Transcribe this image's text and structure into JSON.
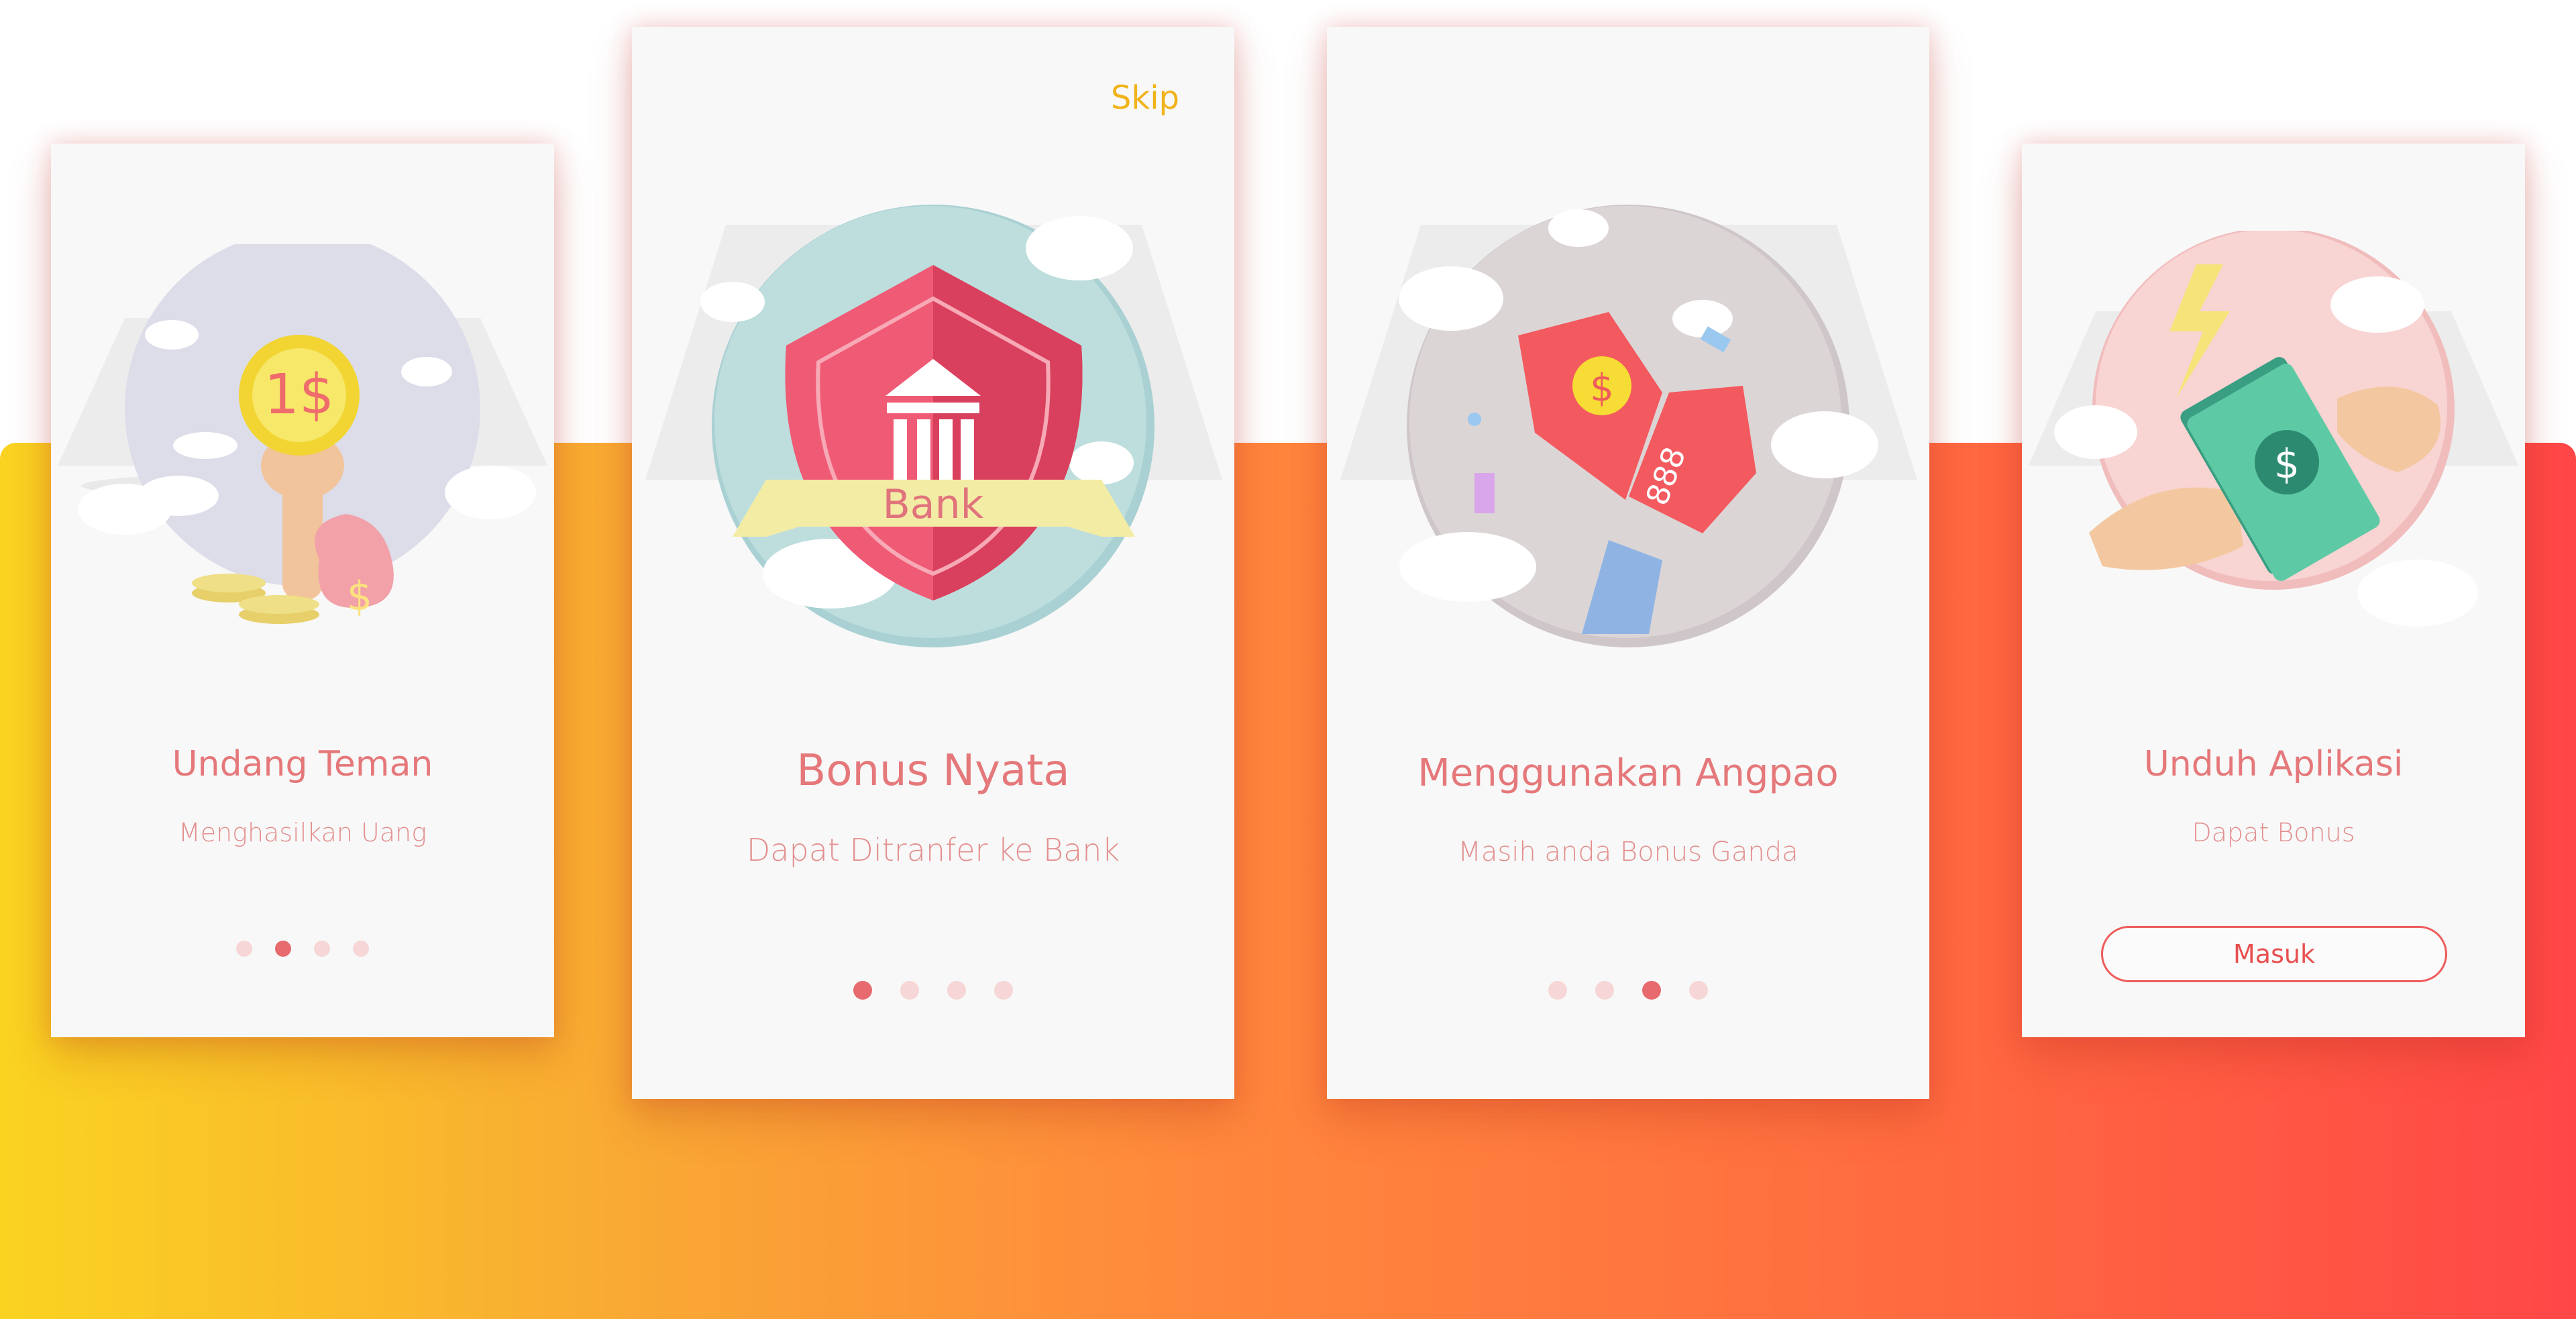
{
  "cards": [
    {
      "title": "Undang Teman",
      "subtitle": "Menghasilkan Uang",
      "coin_text": "1$"
    },
    {
      "title": "Bonus Nyata",
      "subtitle": "Dapat Ditranfer ke Bank",
      "skip": "Skip",
      "shield_text": "Bank"
    },
    {
      "title": "Menggunakan Angpao",
      "subtitle": "Masih anda Bonus Ganda",
      "packet_text": "888"
    },
    {
      "title": "Unduh Aplikasi",
      "subtitle": "Dapat Bonus",
      "button": "Masuk"
    }
  ],
  "pagination": {
    "card1_active": 2,
    "card2_active": 1,
    "card3_active": 3,
    "total": 4
  },
  "icons": [
    "coin-hand-icon",
    "money-bag-icon",
    "bank-shield-icon",
    "red-envelope-icon",
    "cash-handover-icon",
    "lightning-icon",
    "cloud-icon"
  ],
  "colors": {
    "accent_red": "#e76a6e",
    "skip_yellow": "#f1b31a",
    "button_red": "#ee5c5c",
    "gradient_start": "#fad321",
    "gradient_end": "#ff4747"
  }
}
